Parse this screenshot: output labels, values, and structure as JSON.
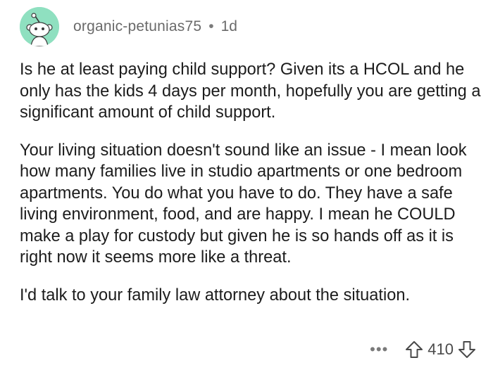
{
  "comment": {
    "author": "organic-petunias75",
    "separator": "•",
    "age": "1d",
    "paragraphs": [
      "Is he at least paying child support? Given its a HCOL and he only has the kids 4 days per month, hopefully you are getting a significant amount of child support.",
      "Your living situation doesn't sound like an issue - I mean look how many families live in studio apartments or one bedroom apartments. You do what you have to do. They have a safe living environment, food, and are happy. I mean he COULD make a play for custody but given he is so hands off as it is right now it seems more like a threat.",
      "I'd talk to your family law attorney about the situation."
    ],
    "more_label": "•••",
    "score": "410"
  },
  "colors": {
    "avatar_bg": "#8fe0c0",
    "text": "#1c1c1c",
    "meta": "#6a6a6a"
  },
  "icons": {
    "avatar": "reddit-snoo-avatar-icon",
    "upvote": "upvote-arrow-icon",
    "downvote": "downvote-arrow-icon",
    "more": "more-options-icon"
  }
}
